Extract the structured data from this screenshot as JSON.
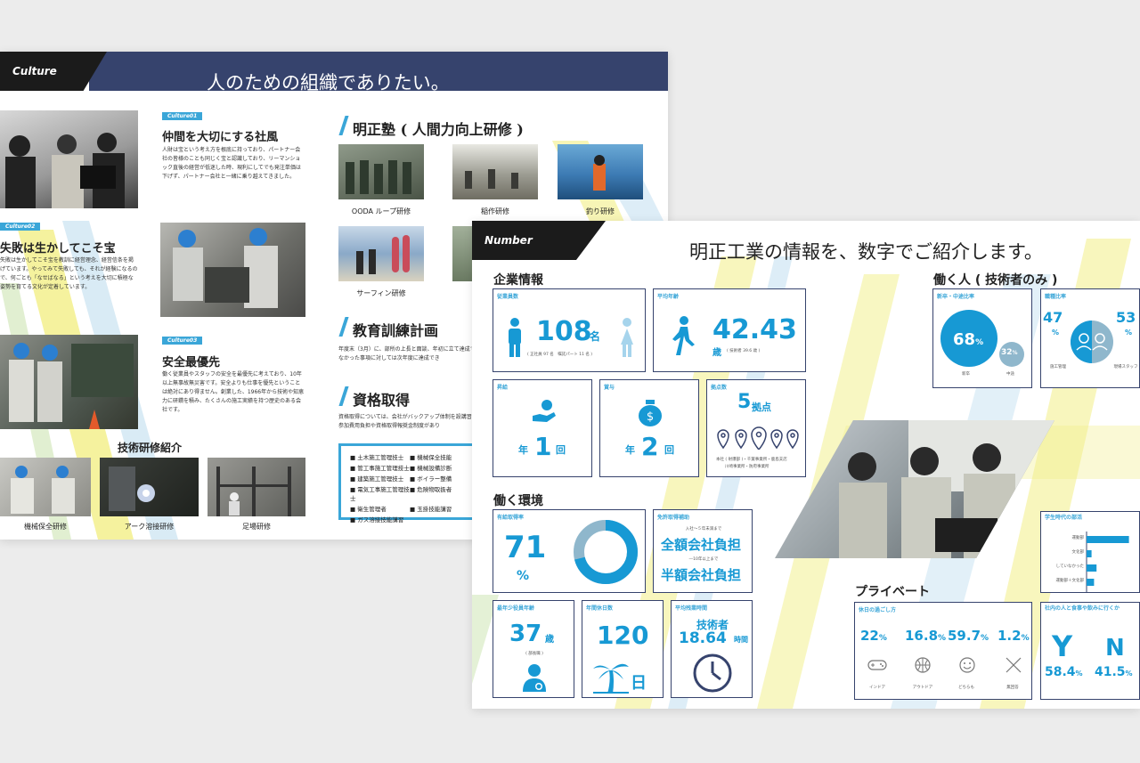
{
  "culture": {
    "tag": "Culture",
    "title": "人のための組織でありたい。",
    "blocks": [
      {
        "badge": "Culture01",
        "heading": "仲間を大切にする社風",
        "text": "人財は宝という考え方を根底に持っており、パートナー会社の皆様のことも同じく宝と認識しており、リーマンショック直後の経営が低迷した時、現利にしてでも発注単価は下げず、パートナー会社と一緒に乗り越えてきました。"
      },
      {
        "badge": "Culture02",
        "heading": "失敗は生かしてこそ宝",
        "text": "失敗は生かしてこそ宝を教訓に経営理念、経営信条を掲げています。やってみて失敗しても、それが経験になるので、何ごとも「なせばなる」という考えを大切に積極な姿勢を育てる文化が定着しています。"
      },
      {
        "badge": "Culture03",
        "heading": "安全最優先",
        "text": "働く従業員やスタッフの安全を最優先に考えており、10年以上無事故無災害です。安全よりも仕事を優先ということは絶対にあり得ません。創業した、1966年から技術や知恵力に研鑽を積み、たくさんの施工実績を持つ歴史のある会社です。"
      }
    ],
    "training_heading": "技術研修紹介",
    "training_captions": [
      "機械保全研修",
      "アーク溶接研修",
      "足場研修"
    ],
    "meisei_heading": "明正塾 ( 人間力向上研修 )",
    "meisei_captions": [
      "OODA ループ研修",
      "稲作研修",
      "釣り研修",
      "サーフィン研修"
    ],
    "plan_heading": "教育訓練計画",
    "plan_text": "年度末（3月）に、部所の上長と面談、年初に立て達成できなかった事項に対しては次年度に達成でき",
    "qual_heading": "資格取得",
    "qual_text": "資格取得については、会社がバックアップ体制を設講習会参加費用負担や資格取得報奨金制度があり",
    "qual_list": [
      "土木施工管理技士",
      "機械保全技能",
      "管工事施工管理技士",
      "機械設備診断",
      "建築施工管理技士",
      "ボイラー整備",
      "電気工事施工管理技士",
      "危険物取扱者",
      "衛生管理者",
      "玉掛技能講習",
      "ガス溶接技能講習",
      ""
    ]
  },
  "number": {
    "tag": "Number",
    "title": "明正工業の情報を、数字でご紹介します。",
    "sec_company": "企業情報",
    "sec_env": "働く環境",
    "sec_people": "働く人 ( 技術者のみ )",
    "sec_private": "プライベート",
    "employees": {
      "label": "従業員数",
      "value": "108",
      "unit": "名",
      "note": "( 正社員 97 名　嘱託パート 11 名 )"
    },
    "avg_age": {
      "label": "平均年齢",
      "value": "42.43",
      "unit": "歳",
      "note": "( 技術者 39.6 歳 )"
    },
    "raise": {
      "label": "昇給",
      "prefix": "年",
      "value": "1",
      "unit": "回"
    },
    "bonus": {
      "label": "賞与",
      "prefix": "年",
      "value": "2",
      "unit": "回"
    },
    "bases": {
      "label": "拠点数",
      "value": "5",
      "unit": "拠点",
      "note1": "本社 ( 射爆部 )・千葉事業所・鹿島支店",
      "note2": "川崎事業所・防府事業所"
    },
    "leave": {
      "label": "有給取得率",
      "value": "71",
      "unit": "%",
      "fraction": 0.71
    },
    "license": {
      "label": "免許取得補助",
      "line1": "入社～５年未満まで",
      "value1": "全額会社負担",
      "line2": "―10年以上まで",
      "value2": "半額会社負担"
    },
    "manager_age": {
      "label": "最年少役員年齢",
      "value": "37",
      "unit": "歳",
      "note": "( 部長職 )"
    },
    "holidays": {
      "label": "年間休日数",
      "value": "120",
      "unit": "日"
    },
    "overtime": {
      "label": "平均残業時間",
      "sub": "技術者",
      "value": "18.64",
      "unit": "時間"
    },
    "hire_ratio": {
      "label": "新卒・中途比率",
      "main": "68",
      "main_label": "新卒",
      "minor": "32",
      "minor_label": "中途",
      "unit": "%"
    },
    "job_ratio": {
      "label": "職種比率",
      "left": "47",
      "left_label": "施工管理",
      "right": "53",
      "right_label": "現場スタッフ",
      "unit": "%"
    },
    "club": {
      "label": "学生時代の部活",
      "items": [
        {
          "name": "運動部",
          "value": 0.85
        },
        {
          "name": "文化部",
          "value": 0.1
        },
        {
          "name": "していなかった",
          "value": 0.2
        },
        {
          "name": "運動部＋文化部",
          "value": 0.15
        }
      ]
    },
    "holiday_style": {
      "label": "休日の過ごし方",
      "items": [
        {
          "value": "22",
          "unit": "%",
          "name": "インドア"
        },
        {
          "value": "16.8",
          "unit": "%",
          "name": "アウトドア"
        },
        {
          "value": "59.7",
          "unit": "%",
          "name": "どちらも"
        },
        {
          "value": "1.2",
          "unit": "%",
          "name": "無回答"
        }
      ]
    },
    "dining": {
      "label": "社内の人と食事や飲みに行くか",
      "yes": "Y",
      "no": "N",
      "yes_value": "58.4",
      "no_value": "41.5",
      "unit": "%"
    }
  },
  "colors": {
    "navy": "#36436d",
    "accent": "#1799d4",
    "light_blue": "#3aa6d8",
    "stripe_yellow": "#f2ef86",
    "stripe_blue": "#cfe6f3",
    "stripe_green": "#d9ebc5"
  }
}
